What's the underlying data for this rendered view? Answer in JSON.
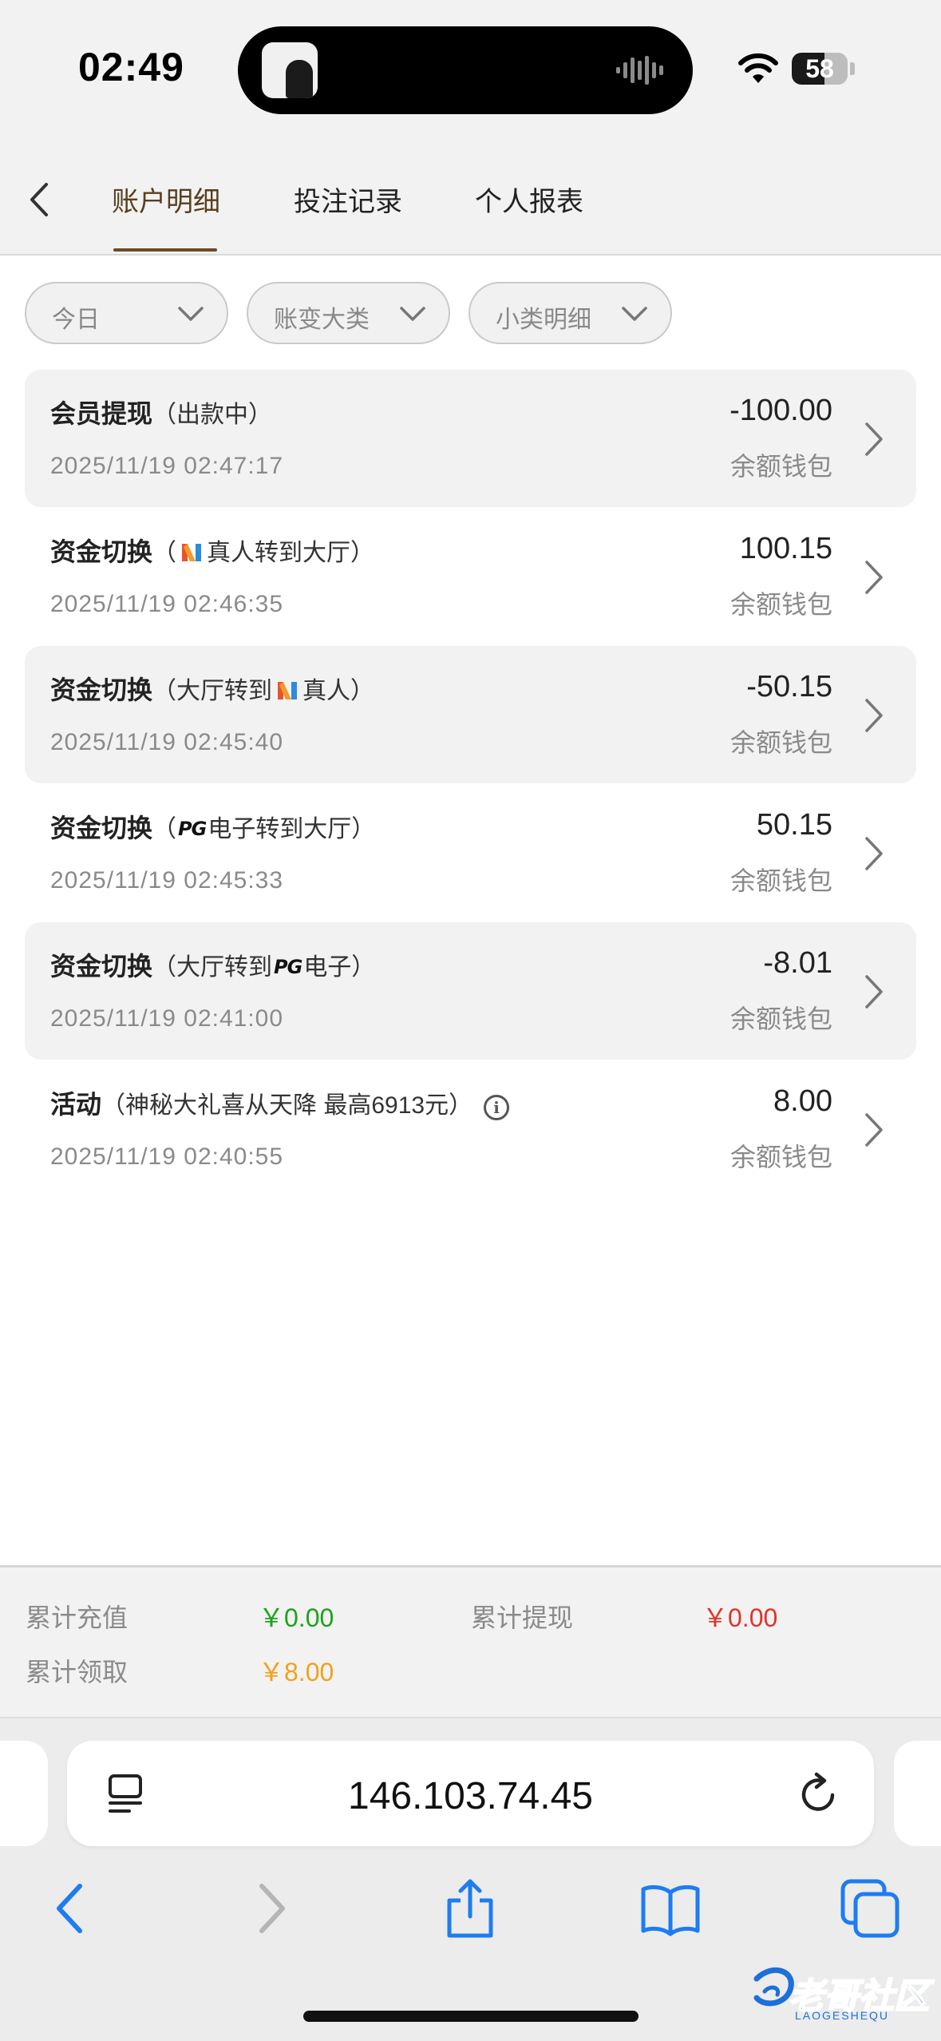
{
  "status_bar": {
    "time": "02:49",
    "battery": "58",
    "battery_level": 0.58
  },
  "header": {
    "tabs": [
      {
        "label": "账户明细",
        "active": true
      },
      {
        "label": "投注记录",
        "active": false
      },
      {
        "label": "个人报表",
        "active": false
      }
    ]
  },
  "filters": [
    {
      "label": "今日"
    },
    {
      "label": "账变大类"
    },
    {
      "label": "小类明细"
    }
  ],
  "records": [
    {
      "title": "会员提现",
      "note_pre": "（出款中）",
      "logo": "",
      "note_post": "",
      "time": "2025/11/19 02:47:17",
      "amount": "-100.00",
      "wallet": "余额钱包"
    },
    {
      "title": "资金切换",
      "note_pre": "（",
      "logo": "n-icon",
      "note_post": "真人转到大厅）",
      "time": "2025/11/19 02:46:35",
      "amount": "100.15",
      "wallet": "余额钱包"
    },
    {
      "title": "资金切换",
      "note_pre": "（大厅转到",
      "logo": "n-icon",
      "note_post": "真人）",
      "time": "2025/11/19 02:45:40",
      "amount": "-50.15",
      "wallet": "余额钱包"
    },
    {
      "title": "资金切换",
      "note_pre": "（",
      "logo": "PG",
      "note_post": "电子转到大厅）",
      "time": "2025/11/19 02:45:33",
      "amount": "50.15",
      "wallet": "余额钱包"
    },
    {
      "title": "资金切换",
      "note_pre": "（大厅转到",
      "logo": "PG",
      "note_post": "电子）",
      "time": "2025/11/19 02:41:00",
      "amount": "-8.01",
      "wallet": "余额钱包"
    },
    {
      "title": "活动",
      "note_pre": "（神秘大礼喜从天降 最高6913元）",
      "logo": "",
      "note_post": "",
      "time": "2025/11/19 02:40:55",
      "amount": "8.00",
      "wallet": "余额钱包"
    }
  ],
  "summary": {
    "recharge_label": "累计充值",
    "recharge_value": "￥0.00",
    "withdraw_label": "累计提现",
    "withdraw_value": "￥0.00",
    "claim_label": "累计领取",
    "claim_value": "￥8.00"
  },
  "colors": {
    "recharge": "#1aa31a",
    "withdraw": "#e0332b",
    "claim": "#f0a21a",
    "accent": "#6b4a26",
    "safari_blue": "#1e7cf2"
  },
  "browser": {
    "url": "146.103.74.45"
  },
  "watermark": {
    "text": "老哥社区",
    "sub": "LAOGESHEQU"
  }
}
